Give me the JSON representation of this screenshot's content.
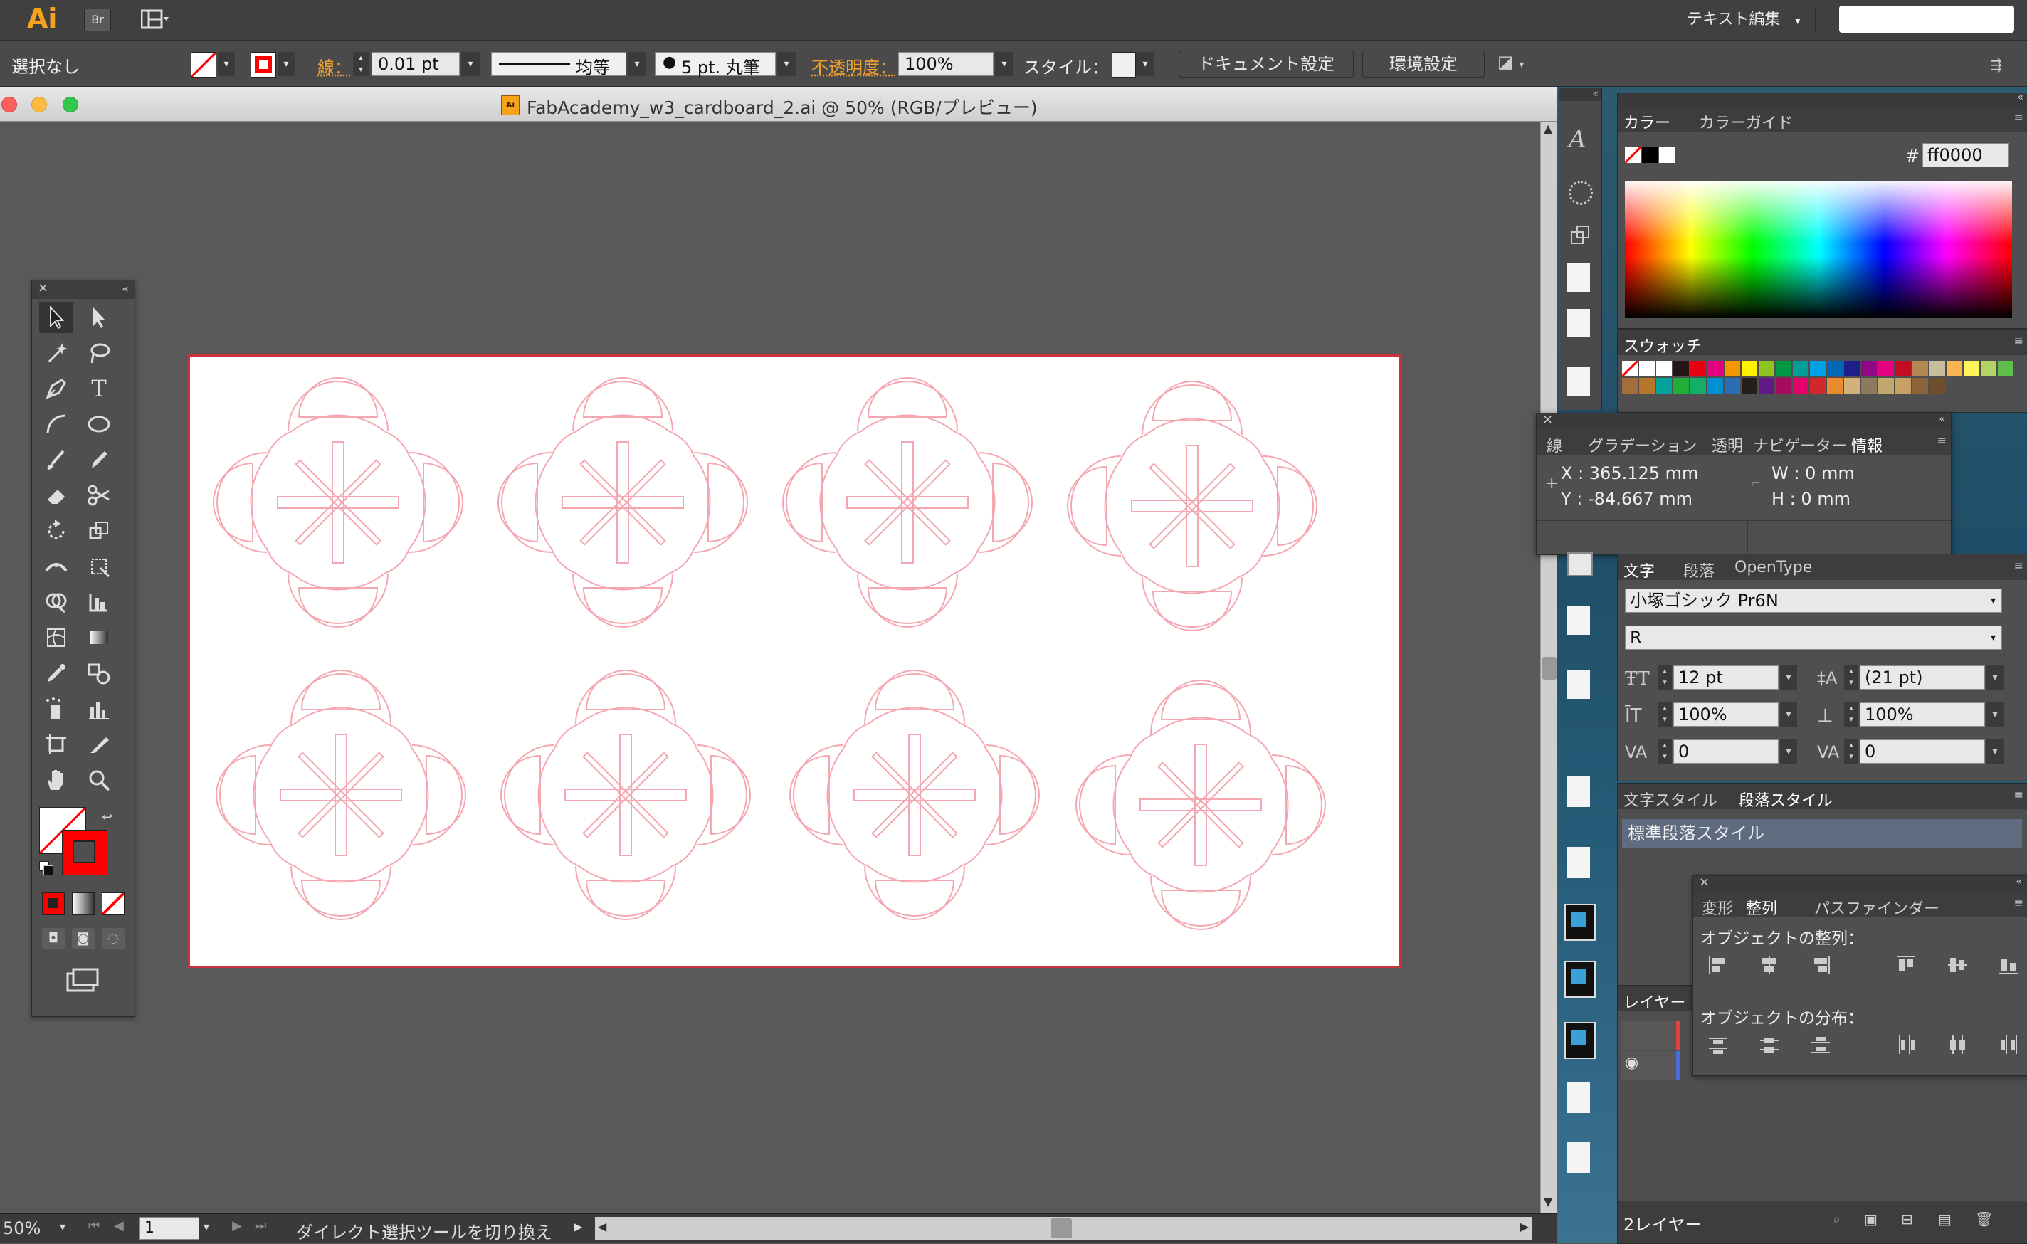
{
  "app": {
    "logo": "Ai",
    "bridge": "Br",
    "workspace_menu": "テキスト編集"
  },
  "control": {
    "selection": "選択なし",
    "stroke_label": "線：",
    "stroke_weight": "0.01 pt",
    "profile": "均等",
    "brush": "5 pt. 丸筆",
    "opacity_label": "不透明度：",
    "opacity": "100%",
    "style_label": "スタイル：",
    "doc_setup": "ドキュメント設定",
    "prefs": "環境設定"
  },
  "document": {
    "title": "FabAcademy_w3_cardboard_2.ai @ 50% (RGB/プレビュー)"
  },
  "status": {
    "zoom": "50%",
    "page": "1",
    "message": "ダイレクト選択ツールを切り換え"
  },
  "color_panel": {
    "tabs": [
      "カラー",
      "カラーガイド"
    ],
    "hex_label": "#",
    "hex": "ff0000"
  },
  "swatches_panel": {
    "title": "スウォッチ"
  },
  "info_panel": {
    "tabs": [
      "線",
      "グラデーション",
      "透明",
      "ナビゲーター",
      "情報"
    ],
    "x": "X : 365.125 mm",
    "y": "Y : -84.667 mm",
    "w": "W : 0 mm",
    "h": "H : 0 mm"
  },
  "type_panel": {
    "tabs": [
      "文字",
      "段落",
      "OpenType"
    ],
    "font": "小塚ゴシック Pr6N",
    "font_style": "R",
    "size": "12 pt",
    "leading": "(21 pt)",
    "vscale": "100%",
    "hscale": "100%",
    "kerning": "0",
    "tracking": "0"
  },
  "styles_panel": {
    "tabs": [
      "文字スタイル",
      "段落スタイル"
    ],
    "item": "標準段落スタイル"
  },
  "align_panel": {
    "tabs": [
      "変形",
      "整列",
      "パスファインダー"
    ],
    "align_label": "オブジェクトの整列：",
    "distribute_label": "オブジェクトの分布："
  },
  "layers_panel": {
    "title": "レイヤー",
    "count": "2レイヤー"
  },
  "colors": {
    "accent": "#ff0000",
    "shape": "#f4a7b0",
    "artboard_border": "#c8323a",
    "ui": "#535353"
  }
}
